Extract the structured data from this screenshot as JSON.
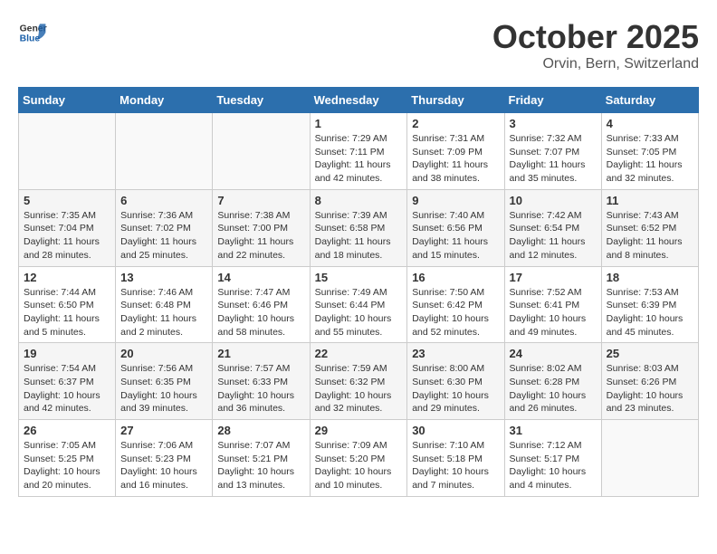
{
  "header": {
    "logo_general": "General",
    "logo_blue": "Blue",
    "month": "October 2025",
    "location": "Orvin, Bern, Switzerland"
  },
  "weekdays": [
    "Sunday",
    "Monday",
    "Tuesday",
    "Wednesday",
    "Thursday",
    "Friday",
    "Saturday"
  ],
  "weeks": [
    [
      {
        "day": "",
        "info": ""
      },
      {
        "day": "",
        "info": ""
      },
      {
        "day": "",
        "info": ""
      },
      {
        "day": "1",
        "info": "Sunrise: 7:29 AM\nSunset: 7:11 PM\nDaylight: 11 hours and 42 minutes."
      },
      {
        "day": "2",
        "info": "Sunrise: 7:31 AM\nSunset: 7:09 PM\nDaylight: 11 hours and 38 minutes."
      },
      {
        "day": "3",
        "info": "Sunrise: 7:32 AM\nSunset: 7:07 PM\nDaylight: 11 hours and 35 minutes."
      },
      {
        "day": "4",
        "info": "Sunrise: 7:33 AM\nSunset: 7:05 PM\nDaylight: 11 hours and 32 minutes."
      }
    ],
    [
      {
        "day": "5",
        "info": "Sunrise: 7:35 AM\nSunset: 7:04 PM\nDaylight: 11 hours and 28 minutes."
      },
      {
        "day": "6",
        "info": "Sunrise: 7:36 AM\nSunset: 7:02 PM\nDaylight: 11 hours and 25 minutes."
      },
      {
        "day": "7",
        "info": "Sunrise: 7:38 AM\nSunset: 7:00 PM\nDaylight: 11 hours and 22 minutes."
      },
      {
        "day": "8",
        "info": "Sunrise: 7:39 AM\nSunset: 6:58 PM\nDaylight: 11 hours and 18 minutes."
      },
      {
        "day": "9",
        "info": "Sunrise: 7:40 AM\nSunset: 6:56 PM\nDaylight: 11 hours and 15 minutes."
      },
      {
        "day": "10",
        "info": "Sunrise: 7:42 AM\nSunset: 6:54 PM\nDaylight: 11 hours and 12 minutes."
      },
      {
        "day": "11",
        "info": "Sunrise: 7:43 AM\nSunset: 6:52 PM\nDaylight: 11 hours and 8 minutes."
      }
    ],
    [
      {
        "day": "12",
        "info": "Sunrise: 7:44 AM\nSunset: 6:50 PM\nDaylight: 11 hours and 5 minutes."
      },
      {
        "day": "13",
        "info": "Sunrise: 7:46 AM\nSunset: 6:48 PM\nDaylight: 11 hours and 2 minutes."
      },
      {
        "day": "14",
        "info": "Sunrise: 7:47 AM\nSunset: 6:46 PM\nDaylight: 10 hours and 58 minutes."
      },
      {
        "day": "15",
        "info": "Sunrise: 7:49 AM\nSunset: 6:44 PM\nDaylight: 10 hours and 55 minutes."
      },
      {
        "day": "16",
        "info": "Sunrise: 7:50 AM\nSunset: 6:42 PM\nDaylight: 10 hours and 52 minutes."
      },
      {
        "day": "17",
        "info": "Sunrise: 7:52 AM\nSunset: 6:41 PM\nDaylight: 10 hours and 49 minutes."
      },
      {
        "day": "18",
        "info": "Sunrise: 7:53 AM\nSunset: 6:39 PM\nDaylight: 10 hours and 45 minutes."
      }
    ],
    [
      {
        "day": "19",
        "info": "Sunrise: 7:54 AM\nSunset: 6:37 PM\nDaylight: 10 hours and 42 minutes."
      },
      {
        "day": "20",
        "info": "Sunrise: 7:56 AM\nSunset: 6:35 PM\nDaylight: 10 hours and 39 minutes."
      },
      {
        "day": "21",
        "info": "Sunrise: 7:57 AM\nSunset: 6:33 PM\nDaylight: 10 hours and 36 minutes."
      },
      {
        "day": "22",
        "info": "Sunrise: 7:59 AM\nSunset: 6:32 PM\nDaylight: 10 hours and 32 minutes."
      },
      {
        "day": "23",
        "info": "Sunrise: 8:00 AM\nSunset: 6:30 PM\nDaylight: 10 hours and 29 minutes."
      },
      {
        "day": "24",
        "info": "Sunrise: 8:02 AM\nSunset: 6:28 PM\nDaylight: 10 hours and 26 minutes."
      },
      {
        "day": "25",
        "info": "Sunrise: 8:03 AM\nSunset: 6:26 PM\nDaylight: 10 hours and 23 minutes."
      }
    ],
    [
      {
        "day": "26",
        "info": "Sunrise: 7:05 AM\nSunset: 5:25 PM\nDaylight: 10 hours and 20 minutes."
      },
      {
        "day": "27",
        "info": "Sunrise: 7:06 AM\nSunset: 5:23 PM\nDaylight: 10 hours and 16 minutes."
      },
      {
        "day": "28",
        "info": "Sunrise: 7:07 AM\nSunset: 5:21 PM\nDaylight: 10 hours and 13 minutes."
      },
      {
        "day": "29",
        "info": "Sunrise: 7:09 AM\nSunset: 5:20 PM\nDaylight: 10 hours and 10 minutes."
      },
      {
        "day": "30",
        "info": "Sunrise: 7:10 AM\nSunset: 5:18 PM\nDaylight: 10 hours and 7 minutes."
      },
      {
        "day": "31",
        "info": "Sunrise: 7:12 AM\nSunset: 5:17 PM\nDaylight: 10 hours and 4 minutes."
      },
      {
        "day": "",
        "info": ""
      }
    ]
  ]
}
